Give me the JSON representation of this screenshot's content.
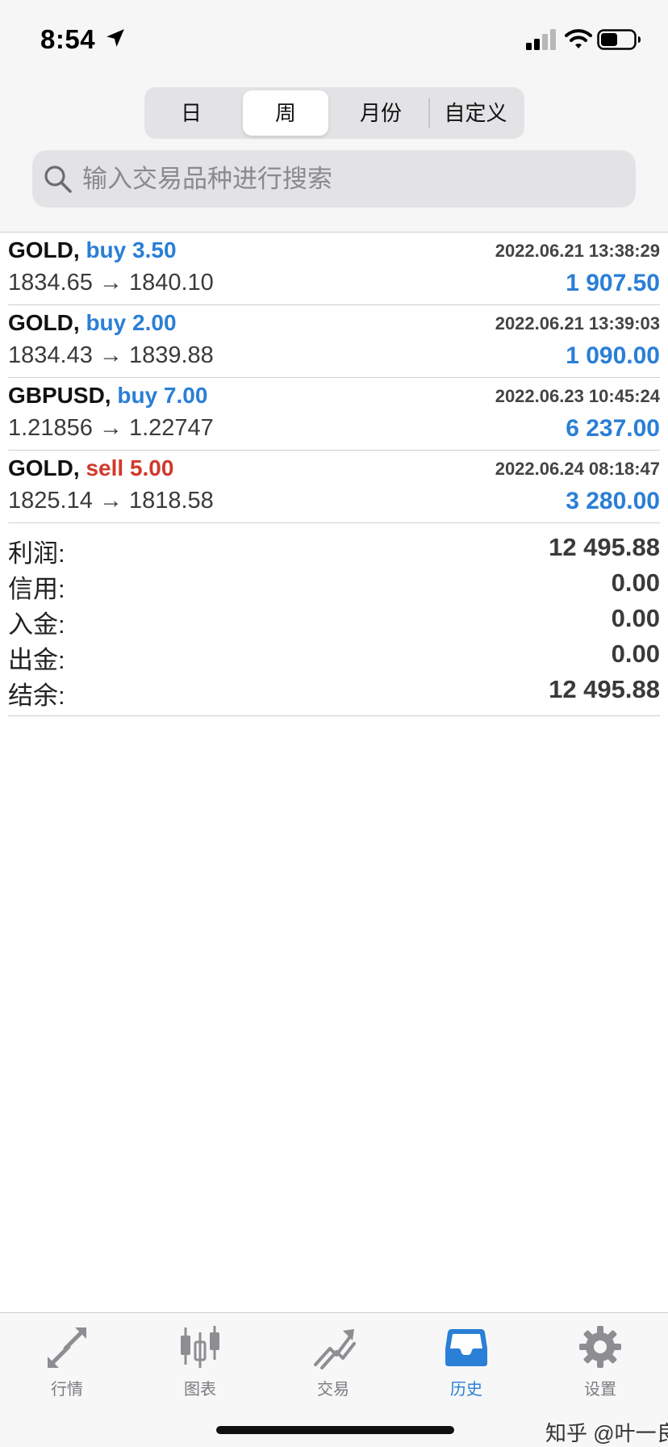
{
  "status_bar": {
    "time": "8:54",
    "icons": [
      "location-arrow-icon",
      "cellular-signal-icon",
      "wifi-icon",
      "battery-icon"
    ]
  },
  "period_tabs": {
    "items": [
      {
        "label": "日"
      },
      {
        "label": "周",
        "selected": true
      },
      {
        "label": "月份"
      },
      {
        "label": "自定义"
      }
    ]
  },
  "search": {
    "placeholder": "输入交易品种进行搜索",
    "value": ""
  },
  "trades": [
    {
      "symbol": "GOLD,",
      "side": "buy",
      "volume": "3.50",
      "datetime": "2022.06.21 13:38:29",
      "open_price": "1834.65",
      "arrow": "→",
      "close_price": "1840.10",
      "profit": "1 907.50"
    },
    {
      "symbol": "GOLD,",
      "side": "buy",
      "volume": "2.00",
      "datetime": "2022.06.21 13:39:03",
      "open_price": "1834.43",
      "arrow": "→",
      "close_price": "1839.88",
      "profit": "1 090.00"
    },
    {
      "symbol": "GBPUSD,",
      "side": "buy",
      "volume": "7.00",
      "datetime": "2022.06.23 10:45:24",
      "open_price": "1.21856",
      "arrow": "→",
      "close_price": "1.22747",
      "profit": "6 237.00"
    },
    {
      "symbol": "GOLD,",
      "side": "sell",
      "volume": "5.00",
      "datetime": "2022.06.24 08:18:47",
      "open_price": "1825.14",
      "arrow": "→",
      "close_price": "1818.58",
      "profit": "3 280.00"
    }
  ],
  "summary": [
    {
      "label": "利润:",
      "value": "12 495.88"
    },
    {
      "label": "信用:",
      "value": "0.00"
    },
    {
      "label": "入金:",
      "value": "0.00"
    },
    {
      "label": "出金:",
      "value": "0.00"
    },
    {
      "label": "结余:",
      "value": "12 495.88"
    }
  ],
  "tab_bar": {
    "items": [
      {
        "label": "行情",
        "icon": "quotes-arrows-icon"
      },
      {
        "label": "图表",
        "icon": "candlestick-chart-icon"
      },
      {
        "label": "交易",
        "icon": "trade-trend-icon"
      },
      {
        "label": "历史",
        "icon": "history-inbox-icon",
        "active": true
      },
      {
        "label": "设置",
        "icon": "settings-gear-icon"
      }
    ]
  },
  "watermark": "知乎 @叶一良",
  "colors": {
    "buy": "#2a7fd6",
    "sell": "#d1392b",
    "profit": "#2a7fd6",
    "tab_active": "#2a7fd6",
    "tab_inactive": "#8e8e92"
  }
}
